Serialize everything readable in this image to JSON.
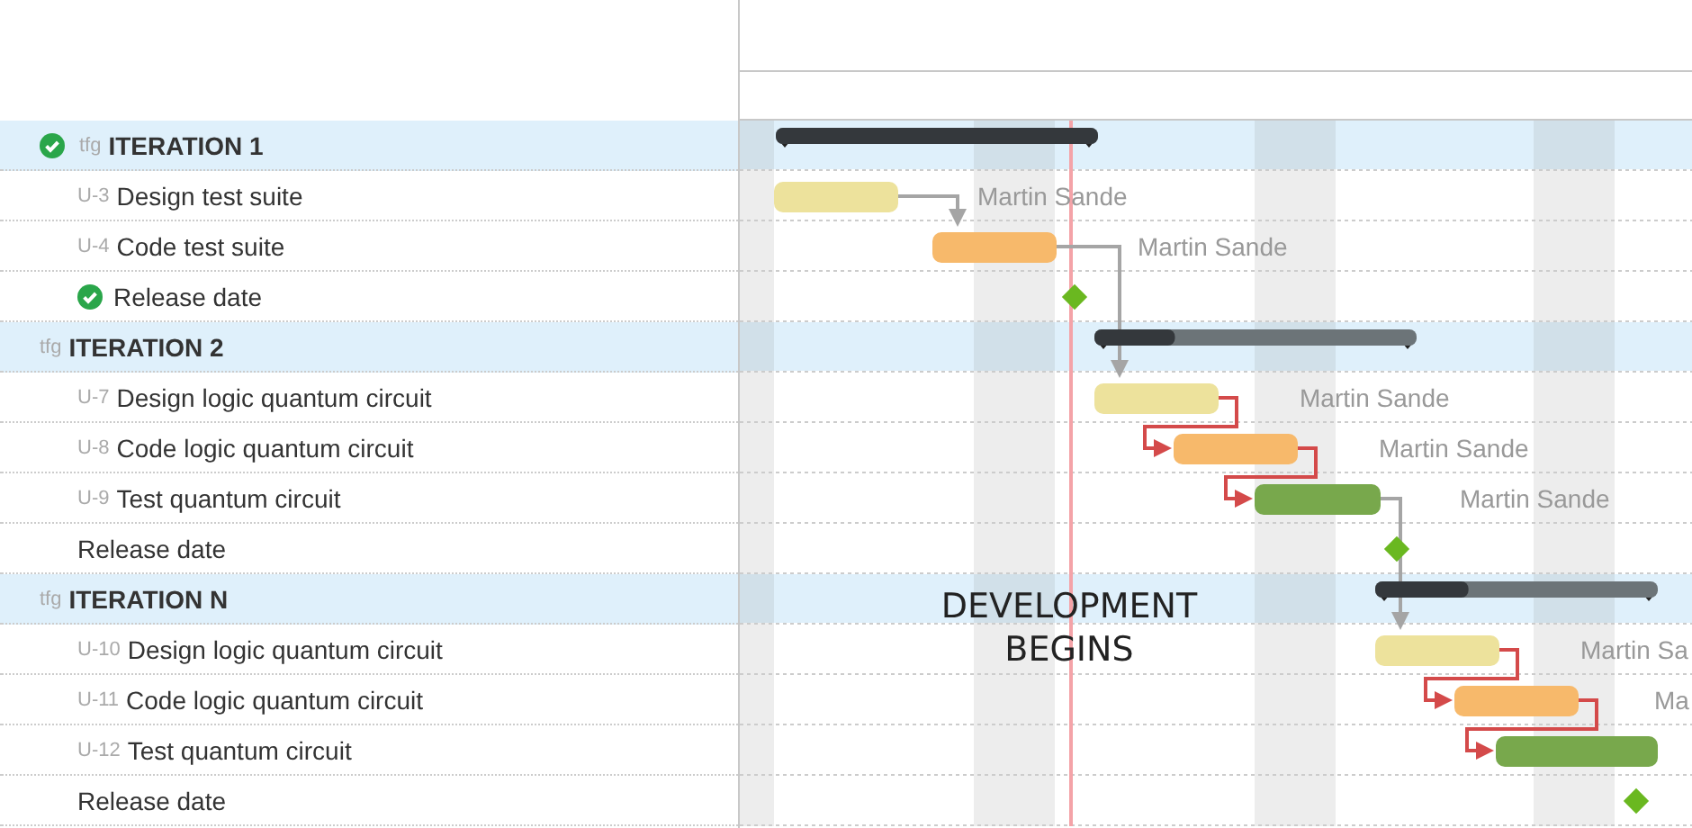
{
  "rows": [
    {
      "kind": "summary",
      "key": "tfg",
      "title": "ITERATION 1",
      "done": true,
      "level": 1
    },
    {
      "kind": "task",
      "key": "U-3",
      "title": "Design test suite",
      "color": "#ede29c",
      "assignee": "Martin Sande",
      "link_critical": false
    },
    {
      "kind": "task",
      "key": "U-4",
      "title": "Code test suite",
      "color": "#f7b96b",
      "assignee": "Martin Sande",
      "link_critical": false
    },
    {
      "kind": "milestone",
      "title": "Release date",
      "done": true
    },
    {
      "kind": "summary",
      "key": "tfg",
      "title": "ITERATION 2",
      "done": false,
      "level": 0.25
    },
    {
      "kind": "task",
      "key": "U-7",
      "title": "Design logic quantum circuit",
      "color": "#ede29c",
      "assignee": "Martin Sande",
      "link_critical": true
    },
    {
      "kind": "task",
      "key": "U-8",
      "title": "Code logic quantum circuit",
      "color": "#f7b96b",
      "assignee": "Martin Sande",
      "link_critical": true
    },
    {
      "kind": "task",
      "key": "U-9",
      "title": "Test quantum circuit",
      "color": "#78a84c",
      "assignee": "Martin Sande",
      "link_critical": false
    },
    {
      "kind": "milestone",
      "title": "Release date",
      "done": false
    },
    {
      "kind": "summary",
      "key": "tfg",
      "title": "ITERATION N",
      "done": false,
      "level": 0.33
    },
    {
      "kind": "task",
      "key": "U-10",
      "title": "Design logic quantum circuit",
      "color": "#ede29c",
      "assignee": "Martin Sa",
      "link_critical": true
    },
    {
      "kind": "task",
      "key": "U-11",
      "title": "Code logic quantum circuit",
      "color": "#f7b96b",
      "assignee": "Ma",
      "link_critical": true
    },
    {
      "kind": "task",
      "key": "U-12",
      "title": "Test quantum circuit",
      "color": "#78a84c"
    },
    {
      "kind": "milestone",
      "title": "Release date",
      "done": false
    }
  ],
  "annotation": {
    "lines": [
      "DEVELOPMENT",
      "BEGINS"
    ]
  }
}
